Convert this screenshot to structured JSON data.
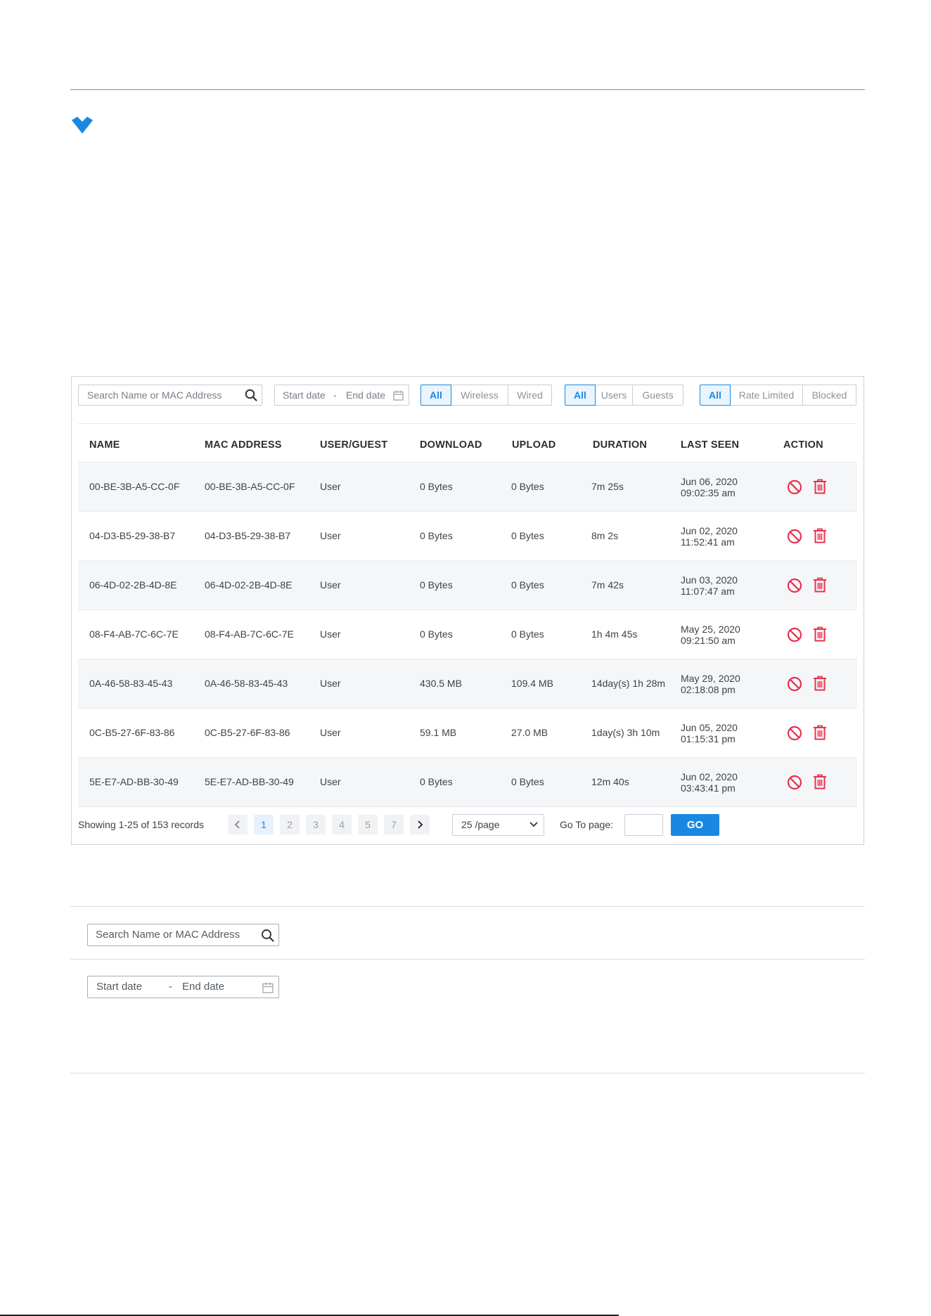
{
  "toolbar": {
    "search_placeholder": "Search Name or MAC Address",
    "start_date": "Start date",
    "date_sep": "-",
    "end_date": "End date",
    "connection_filter": [
      "All",
      "Wireless",
      "Wired"
    ],
    "user_filter": [
      "All",
      "Users",
      "Guests"
    ],
    "status_filter": [
      "All",
      "Rate Limited",
      "Blocked"
    ]
  },
  "table": {
    "headers": [
      "NAME",
      "MAC ADDRESS",
      "USER/GUEST",
      "DOWNLOAD",
      "UPLOAD",
      "DURATION",
      "LAST SEEN",
      "ACTION"
    ],
    "rows": [
      {
        "name": "00-BE-3B-A5-CC-0F",
        "mac": "00-BE-3B-A5-CC-0F",
        "type": "User",
        "download": "0 Bytes",
        "upload": "0 Bytes",
        "duration": "7m 25s",
        "date": "Jun 06, 2020",
        "time": "09:02:35 am"
      },
      {
        "name": "04-D3-B5-29-38-B7",
        "mac": "04-D3-B5-29-38-B7",
        "type": "User",
        "download": "0 Bytes",
        "upload": "0 Bytes",
        "duration": "8m 2s",
        "date": "Jun 02, 2020",
        "time": "11:52:41 am"
      },
      {
        "name": "06-4D-02-2B-4D-8E",
        "mac": "06-4D-02-2B-4D-8E",
        "type": "User",
        "download": "0 Bytes",
        "upload": "0 Bytes",
        "duration": "7m 42s",
        "date": "Jun 03, 2020",
        "time": "11:07:47 am"
      },
      {
        "name": "08-F4-AB-7C-6C-7E",
        "mac": "08-F4-AB-7C-6C-7E",
        "type": "User",
        "download": "0 Bytes",
        "upload": "0 Bytes",
        "duration": "1h 4m 45s",
        "date": "May 25, 2020",
        "time": "09:21:50 am"
      },
      {
        "name": "0A-46-58-83-45-43",
        "mac": "0A-46-58-83-45-43",
        "type": "User",
        "download": "430.5 MB",
        "upload": "109.4 MB",
        "duration": "14day(s) 1h 28m",
        "date": "May 29, 2020",
        "time": "02:18:08 pm"
      },
      {
        "name": "0C-B5-27-6F-83-86",
        "mac": "0C-B5-27-6F-83-86",
        "type": "User",
        "download": "59.1 MB",
        "upload": "27.0 MB",
        "duration": "1day(s) 3h 10m",
        "date": "Jun 05, 2020",
        "time": "01:15:31 pm"
      },
      {
        "name": "5E-E7-AD-BB-30-49",
        "mac": "5E-E7-AD-BB-30-49",
        "type": "User",
        "download": "0 Bytes",
        "upload": "0 Bytes",
        "duration": "12m 40s",
        "date": "Jun 02, 2020",
        "time": "03:43:41 pm"
      }
    ]
  },
  "pagination": {
    "records_text": "Showing 1-25 of 153 records",
    "pages": [
      "1",
      "2",
      "3",
      "4",
      "5",
      "7"
    ],
    "current_page": "1",
    "per_page": "25 /page",
    "goto_label": "Go To page:",
    "go_label": "GO"
  },
  "lower": {
    "search_placeholder": "Search Name or MAC Address",
    "start_date": "Start date",
    "date_sep": "-",
    "end_date": "End date"
  },
  "colors": {
    "accent": "#1a88e0",
    "danger": "#e8314f",
    "chevron": "#1a88e0"
  }
}
